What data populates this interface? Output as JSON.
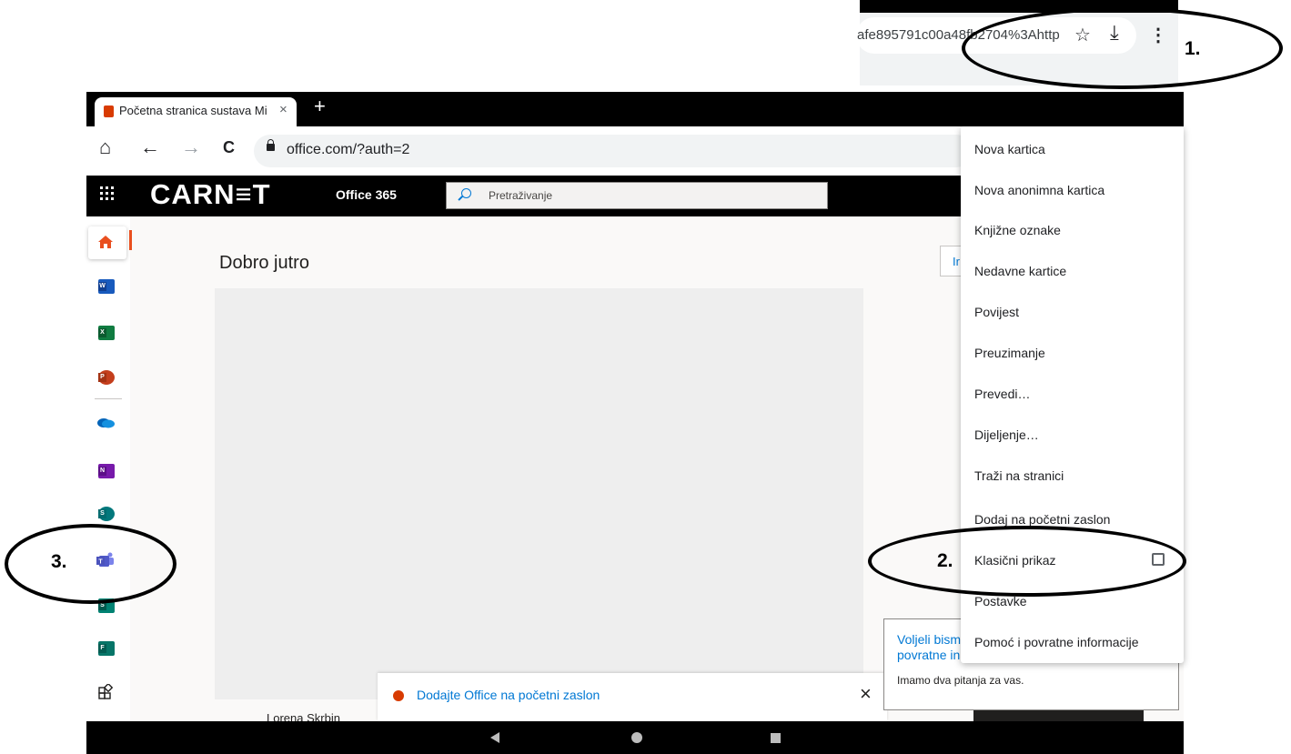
{
  "inset": {
    "url_fragment": "afe895791c00a48fb2704%3Ahttp",
    "star_icon": "☆",
    "download_icon": "⤓",
    "more_icon": "⋮"
  },
  "browser": {
    "tab_title": "Početna stranica sustava Mi",
    "tab_close": "×",
    "new_tab": "+",
    "back": "←",
    "forward": "→",
    "home": "⌂",
    "reload": "C",
    "url": "office.com/?auth=2"
  },
  "office_header": {
    "brand": "CARN≡T",
    "product": "Office 365",
    "search_placeholder": "Pretraživanje"
  },
  "rail_apps": [
    {
      "name": "word",
      "letter": "W",
      "color": "#185abd"
    },
    {
      "name": "excel",
      "letter": "X",
      "color": "#107c41"
    },
    {
      "name": "powerpoint",
      "letter": "P",
      "color": "#c43e1c"
    },
    {
      "name": "onedrive",
      "letter": "",
      "color": "#0364b8"
    },
    {
      "name": "onenote",
      "letter": "N",
      "color": "#7719aa"
    },
    {
      "name": "sharepoint",
      "letter": "S",
      "color": "#03787c"
    },
    {
      "name": "teams",
      "letter": "",
      "color": "#5059c9"
    },
    {
      "name": "sway",
      "letter": "S",
      "color": "#008272"
    },
    {
      "name": "forms",
      "letter": "F",
      "color": "#077568"
    }
  ],
  "main": {
    "greeting": "Dobro jutro",
    "install_stub": "Ir",
    "add_office": "Dodajte Office na početni zaslon",
    "close": "×",
    "file_owner": "Lorena Skrbin"
  },
  "feedback": {
    "title": "Voljeli bismo povratne in",
    "body": "Imamo dva pitanja za vas."
  },
  "menu": {
    "items": [
      "Nova kartica",
      "Nova anonimna kartica",
      "Knjižne oznake",
      "Nedavne kartice",
      "Povijest",
      "Preuzimanje",
      "Prevedi…",
      "Dijeljenje…",
      "Traži na stranici",
      "Dodaj na početni zaslon",
      "Klasični prikaz",
      "Postavke",
      "Pomoć i povratne informacije"
    ]
  },
  "annotations": {
    "step1": "1.",
    "step2": "2.",
    "step3": "3."
  }
}
